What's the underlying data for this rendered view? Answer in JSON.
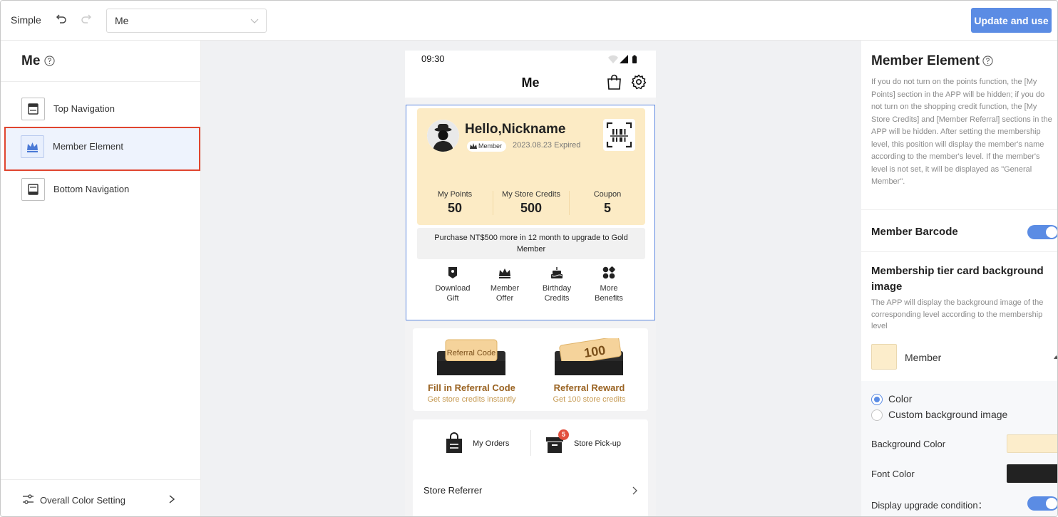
{
  "topbar": {
    "mode": "Simple",
    "page_select_value": "Me",
    "update_button": "Update and use"
  },
  "left_panel": {
    "title": "Me",
    "items": [
      {
        "label": "Top Navigation",
        "icon": "top-navigation-icon"
      },
      {
        "label": "Member Element",
        "icon": "member-crown-icon",
        "active": true
      },
      {
        "label": "Bottom Navigation",
        "icon": "bottom-navigation-icon"
      }
    ],
    "footer": {
      "label": "Overall Color Setting",
      "icon": "sliders-icon"
    }
  },
  "phone": {
    "time": "09:30",
    "header_title": "Me",
    "member_card": {
      "greeting": "Hello,Nickname",
      "tier": "Member",
      "expiry": "2023.08.23 Expired",
      "stats": [
        {
          "label": "My Points",
          "value": "50"
        },
        {
          "label": "My Store Credits",
          "value": "500"
        },
        {
          "label": "Coupon",
          "value": "5"
        }
      ]
    },
    "upgrade_note": "Purchase NT$500 more in 12 month to upgrade to Gold Member",
    "benefits": [
      {
        "line1": "Download",
        "line2": "Gift",
        "icon": "gift-tag-icon"
      },
      {
        "line1": "Member",
        "line2": "Offer",
        "icon": "crown-icon"
      },
      {
        "line1": "Birthday",
        "line2": "Credits",
        "icon": "cake-icon"
      },
      {
        "line1": "More",
        "line2": "Benefits",
        "icon": "grid-icon"
      }
    ],
    "referral": [
      {
        "title": "Fill in Referral Code",
        "subtitle": "Get store credits instantly",
        "ticket_text": "Referral Code"
      },
      {
        "title": "Referral Reward",
        "subtitle": "Get 100 store credits",
        "ticket_text": "100"
      }
    ],
    "orders": [
      {
        "label": "My Orders",
        "icon": "shopping-bag-icon"
      },
      {
        "label": "Store Pick-up",
        "icon": "store-box-icon",
        "badge": "5"
      }
    ],
    "referrer_row": "Store Referrer"
  },
  "right_panel": {
    "title": "Member Element",
    "description": "If you do not turn on the points function, the [My Points] section in the APP will be hidden; if you do not turn on the shopping credit function, the [My Store Credits] and [Member Referral] sections in the APP will be hidden. After setting the membership level, this position will display the member's name according to the member's level. If the member's level is not set, it will be displayed as \"General Member\".",
    "barcode_label": "Member Barcode",
    "barcode_enabled": true,
    "tier_bg_title": "Membership tier card background image",
    "tier_bg_desc": "The APP will display the background image of the corresponding level according to the membership level",
    "tier_name": "Member",
    "radio_color": "Color",
    "radio_custom": "Custom background image",
    "bg_color_label": "Background Color",
    "bg_color": "#fcedcb",
    "font_color_label": "Font Color",
    "font_color": "#222222",
    "upgrade_label": "Display upgrade condition：",
    "upgrade_enabled": true,
    "accent": "#5b8ce4"
  }
}
